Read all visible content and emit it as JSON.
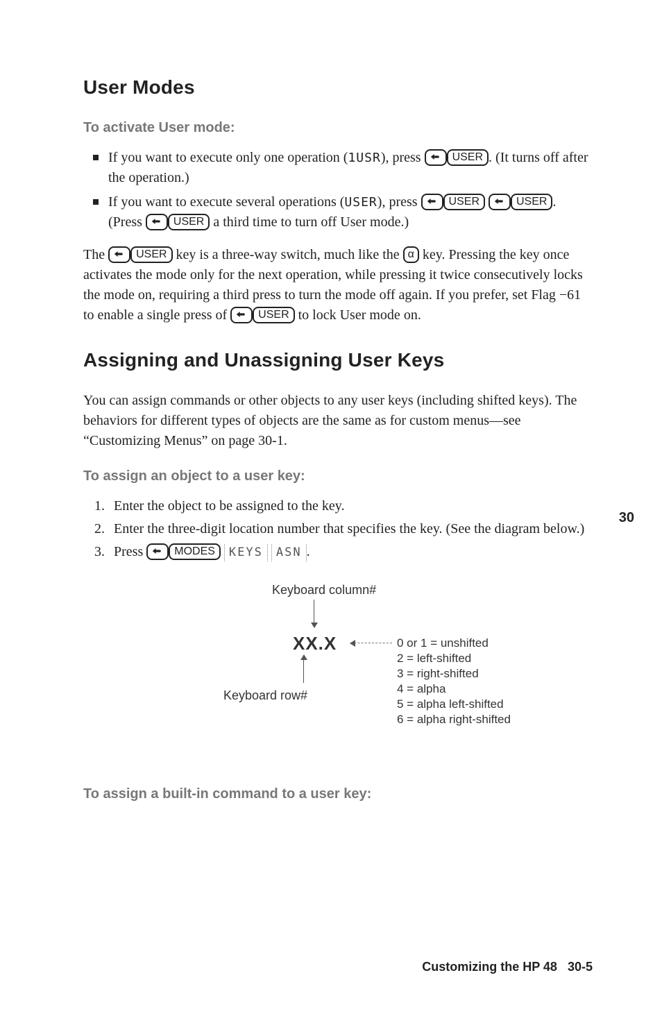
{
  "headings": {
    "user_modes": "User Modes",
    "assigning": "Assigning and Unassigning User Keys"
  },
  "ledes": {
    "activate": "To activate User mode:",
    "assign_object": "To assign an object to a user key:",
    "assign_builtin": "To assign a built-in command to a user key:"
  },
  "bullets": {
    "b1a": "If you want to execute only one operation (",
    "b1a_code": "1USR",
    "b1b": "), press ",
    "b1c": ". (It turns off after the operation.)",
    "b2a": "If you want to execute several operations (",
    "b2a_code": "USER",
    "b2b": "), press ",
    "b2c": ". (Press ",
    "b2d": " a third time to turn off User mode.)"
  },
  "para": {
    "p1a": "The ",
    "p1b": " key is a three-way switch, much like the ",
    "p1c": " key. Pressing the key once activates the mode only for the next operation, while pressing it twice consecutively locks the mode on, requiring a third press to turn the mode off again. If you prefer, set Flag −61 to enable a single press of ",
    "p1d": " to lock User mode on.",
    "p2": "You can assign commands or other objects to any user keys (including shifted keys). The behaviors for different types of objects are the same as for custom menus—see “Customizing Menus” on page 30-1."
  },
  "steps": {
    "s1": "Enter the object to be assigned to the key.",
    "s2": "Enter the three-digit location number that specifies the key. (See the diagram below.)",
    "s3a": "Press ",
    "s3b": "."
  },
  "keys": {
    "user": "USER",
    "modes": "MODES",
    "alpha": "α"
  },
  "soft": {
    "keys": "KEYS",
    "asn": "ASN"
  },
  "side_chapter": "30",
  "diagram": {
    "col": "Keyboard column#",
    "row": "Keyboard row#",
    "xx": "XX.X",
    "n0": "0 or 1 = unshifted",
    "n2": "2 = left-shifted",
    "n3": "3 = right-shifted",
    "n4": "4 = alpha",
    "n5": "5 = alpha left-shifted",
    "n6": "6 = alpha right-shifted"
  },
  "footer": {
    "title": "Customizing the HP 48",
    "page": "30-5"
  }
}
